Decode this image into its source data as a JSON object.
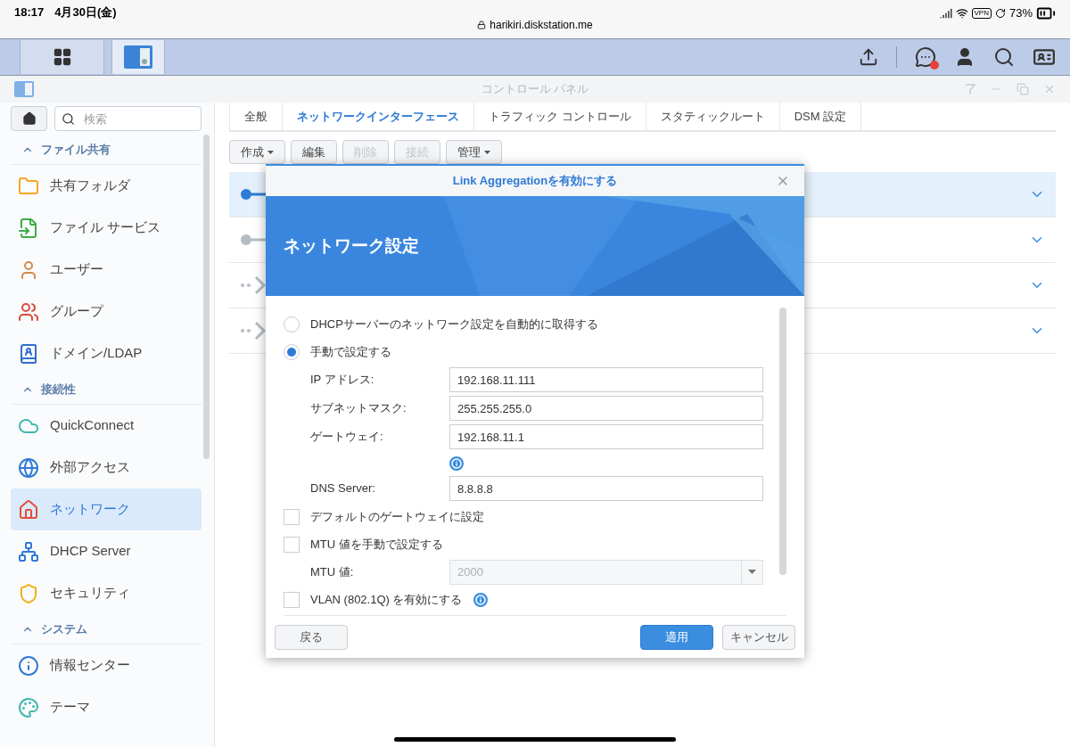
{
  "status_bar": {
    "time": "18:17",
    "date": "4月30日(金)",
    "url": "harikiri.diskstation.me",
    "vpn": "VPN",
    "battery": "73%"
  },
  "taskbar": {
    "apps": [
      {
        "selected": false
      },
      {
        "selected": true
      }
    ],
    "has_notification": true
  },
  "window": {
    "title": "コントロール パネル"
  },
  "sidebar": {
    "search": {
      "placeholder": "検索"
    },
    "sections": [
      {
        "label": "ファイル共有",
        "expanded": true,
        "items": [
          {
            "label": "共有フォルダ",
            "selected": false
          },
          {
            "label": "ファイル サービス",
            "selected": false
          },
          {
            "label": "ユーザー",
            "selected": false
          },
          {
            "label": "グループ",
            "selected": false
          },
          {
            "label": "ドメイン/LDAP",
            "selected": false
          }
        ]
      },
      {
        "label": "接続性",
        "expanded": true,
        "items": [
          {
            "label": "QuickConnect",
            "selected": false
          },
          {
            "label": "外部アクセス",
            "selected": false
          },
          {
            "label": "ネットワーク",
            "selected": true
          },
          {
            "label": "DHCP Server",
            "selected": false
          },
          {
            "label": "セキュリティ",
            "selected": false
          }
        ]
      },
      {
        "label": "システム",
        "expanded": true,
        "items": [
          {
            "label": "情報センター",
            "selected": false
          },
          {
            "label": "テーマ",
            "selected": false
          }
        ]
      }
    ]
  },
  "tabs": [
    {
      "label": "全般",
      "selected": false
    },
    {
      "label": "ネットワークインターフェース",
      "selected": true
    },
    {
      "label": "トラフィック コントロール",
      "selected": false
    },
    {
      "label": "スタティックルート",
      "selected": false
    },
    {
      "label": "DSM 設定",
      "selected": false
    }
  ],
  "toolbar": [
    {
      "label": "作成",
      "has_menu": true,
      "disabled": false
    },
    {
      "label": "編集",
      "has_menu": false,
      "disabled": false
    },
    {
      "label": "削除",
      "has_menu": false,
      "disabled": true
    },
    {
      "label": "接続",
      "has_menu": false,
      "disabled": true
    },
    {
      "label": "管理",
      "has_menu": true,
      "disabled": false
    }
  ],
  "interfaces": [
    {
      "kind": "connected",
      "selected": true
    },
    {
      "kind": "idle",
      "selected": false
    },
    {
      "kind": "disconnected",
      "selected": false
    },
    {
      "kind": "disconnected",
      "selected": false
    }
  ],
  "dialog": {
    "title": "Link Aggregationを有効にする",
    "heading": "ネットワーク設定",
    "options": [
      {
        "label": "DHCPサーバーのネットワーク設定を自動的に取得する",
        "selected": false
      },
      {
        "label": "手動で設定する",
        "selected": true
      }
    ],
    "fields": [
      {
        "label": "IP アドレス:",
        "value": "192.168.11.111",
        "info": false
      },
      {
        "label": "サブネットマスク:",
        "value": "255.255.255.0",
        "info": false
      },
      {
        "label": "ゲートウェイ:",
        "value": "192.168.11.1",
        "info": true
      },
      {
        "label": "DNS Server:",
        "value": "8.8.8.8",
        "info": false
      }
    ],
    "settings": [
      {
        "kind": "checkbox",
        "label": "デフォルトのゲートウェイに設定",
        "checked": false,
        "info": false
      },
      {
        "kind": "checkbox",
        "label": "MTU 値を手動で設定する",
        "checked": false,
        "info": false
      },
      {
        "kind": "select",
        "label": "MTU 値:",
        "value": "2000",
        "disabled": true
      },
      {
        "kind": "checkbox",
        "label": "VLAN (802.1Q) を有効にする",
        "checked": false,
        "info": true
      }
    ],
    "back_button": "戻る",
    "actions": [
      {
        "label": "適用",
        "primary": true
      },
      {
        "label": "キャンセル",
        "primary": false
      }
    ]
  }
}
